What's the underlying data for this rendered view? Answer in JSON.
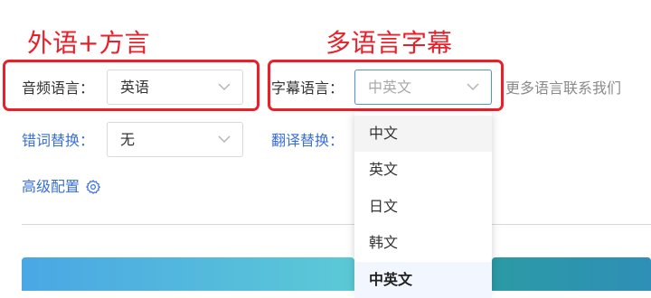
{
  "annotations": {
    "left_title": "外语+方言",
    "right_title": "多语言字幕"
  },
  "audio_language": {
    "label": "音频语言：",
    "value": "英语"
  },
  "subtitle_language": {
    "label": "字幕语言：",
    "placeholder": "中英文",
    "more_text": "更多语言联系我们",
    "options": [
      {
        "label": "中文",
        "state": "hover"
      },
      {
        "label": "英文",
        "state": "normal"
      },
      {
        "label": "日文",
        "state": "normal"
      },
      {
        "label": "韩文",
        "state": "normal"
      },
      {
        "label": "中英文",
        "state": "selected"
      }
    ]
  },
  "typo_replace": {
    "label": "错词替换：",
    "value": "无"
  },
  "translation_replace": {
    "label": "翻译替换："
  },
  "advanced": {
    "label": "高级配置",
    "icon": "gear-icon"
  },
  "colors": {
    "annotation_red": "#e8202a",
    "link_blue": "#3a6fd8",
    "focus_blue": "#4e8ef7"
  }
}
